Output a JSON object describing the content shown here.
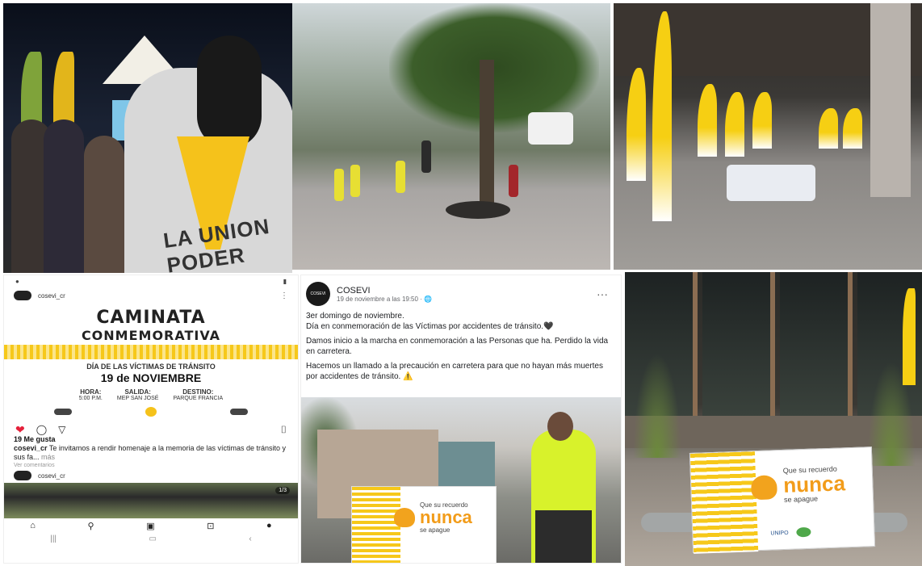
{
  "tile1": {
    "shirt_text": "LA UNION PODER"
  },
  "instagram": {
    "username": "cosevi_cr",
    "more_icon": "more-vertical-icon",
    "poster": {
      "title_line1": "CAMINATA",
      "title_line2": "CONMEMORATIVA",
      "subtitle": "DÍA DE LAS VÍCTIMAS DE TRÁNSITO",
      "date": "19 de NOVIEMBRE",
      "info": [
        {
          "label": "HORA:",
          "value": "5:00 P.M."
        },
        {
          "label": "SALIDA:",
          "value": "MEP SAN JOSÉ"
        },
        {
          "label": "DESTINO:",
          "value": "PARQUE FRANCIA"
        }
      ]
    },
    "likes": "19 Me gusta",
    "caption_user": "cosevi_cr",
    "caption_text": "Te invitamos a rendir homenaje a la memoria de las víctimas de tránsito y sus fa...",
    "caption_more": "más",
    "comments": "Ver comentarios",
    "next_user": "cosevi_cr",
    "carousel_counter": "1/3"
  },
  "facebook": {
    "page_name": "COSEVI",
    "avatar_text": "COSEVI",
    "timestamp": "19 de noviembre a las 19:50 · 🌐",
    "paragraphs": [
      "3er domingo de noviembre.",
      "Día en conmemoración de las Víctimas por accidentes de tránsito.🖤",
      "Damos inicio a la marcha en conmemoración a las Personas que ha. Perdido la vida en carretera.",
      "Hacemos un llamado a la precaución en carretera para que no hayan más muertes por accidentes de tránsito. ⚠️"
    ],
    "banner": {
      "slogan_line1": "Que su recuerdo",
      "slogan_nunca": "nunca",
      "slogan_line2": "se apague"
    }
  },
  "tile6": {
    "banner": {
      "slogan_line1": "Que su recuerdo",
      "slogan_nunca": "nunca",
      "slogan_line2": "se apague",
      "logo1": "UNIPO"
    }
  },
  "colors": {
    "brand_yellow": "#f6c81a",
    "slogan_orange": "#f29c1a",
    "like_red": "#e5203a"
  }
}
